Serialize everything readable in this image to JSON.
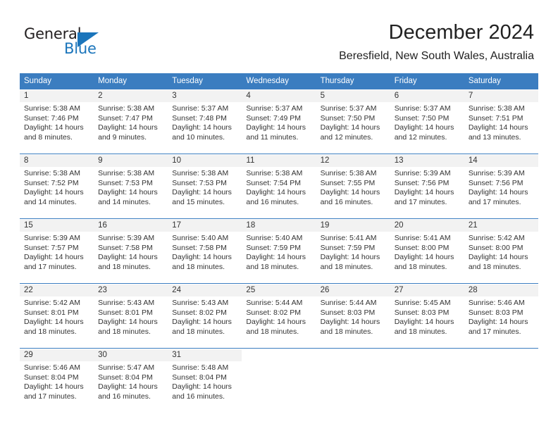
{
  "brand": {
    "name_part1": "General",
    "name_part2": "Blue",
    "triangle_icon": "blue-triangle-logo-icon",
    "accent_color": "#1b75bb"
  },
  "header": {
    "month_title": "December 2024",
    "location": "Beresfield, New South Wales, Australia"
  },
  "calendar": {
    "header_background": "#3b7dc0",
    "daynum_background": "#f2f2f2",
    "weekday_headers": [
      "Sunday",
      "Monday",
      "Tuesday",
      "Wednesday",
      "Thursday",
      "Friday",
      "Saturday"
    ],
    "weeks": [
      [
        {
          "day": "1",
          "sunrise": "Sunrise: 5:38 AM",
          "sunset": "Sunset: 7:46 PM",
          "daylight_line1": "Daylight: 14 hours",
          "daylight_line2": "and 8 minutes."
        },
        {
          "day": "2",
          "sunrise": "Sunrise: 5:38 AM",
          "sunset": "Sunset: 7:47 PM",
          "daylight_line1": "Daylight: 14 hours",
          "daylight_line2": "and 9 minutes."
        },
        {
          "day": "3",
          "sunrise": "Sunrise: 5:37 AM",
          "sunset": "Sunset: 7:48 PM",
          "daylight_line1": "Daylight: 14 hours",
          "daylight_line2": "and 10 minutes."
        },
        {
          "day": "4",
          "sunrise": "Sunrise: 5:37 AM",
          "sunset": "Sunset: 7:49 PM",
          "daylight_line1": "Daylight: 14 hours",
          "daylight_line2": "and 11 minutes."
        },
        {
          "day": "5",
          "sunrise": "Sunrise: 5:37 AM",
          "sunset": "Sunset: 7:50 PM",
          "daylight_line1": "Daylight: 14 hours",
          "daylight_line2": "and 12 minutes."
        },
        {
          "day": "6",
          "sunrise": "Sunrise: 5:37 AM",
          "sunset": "Sunset: 7:50 PM",
          "daylight_line1": "Daylight: 14 hours",
          "daylight_line2": "and 12 minutes."
        },
        {
          "day": "7",
          "sunrise": "Sunrise: 5:38 AM",
          "sunset": "Sunset: 7:51 PM",
          "daylight_line1": "Daylight: 14 hours",
          "daylight_line2": "and 13 minutes."
        }
      ],
      [
        {
          "day": "8",
          "sunrise": "Sunrise: 5:38 AM",
          "sunset": "Sunset: 7:52 PM",
          "daylight_line1": "Daylight: 14 hours",
          "daylight_line2": "and 14 minutes."
        },
        {
          "day": "9",
          "sunrise": "Sunrise: 5:38 AM",
          "sunset": "Sunset: 7:53 PM",
          "daylight_line1": "Daylight: 14 hours",
          "daylight_line2": "and 14 minutes."
        },
        {
          "day": "10",
          "sunrise": "Sunrise: 5:38 AM",
          "sunset": "Sunset: 7:53 PM",
          "daylight_line1": "Daylight: 14 hours",
          "daylight_line2": "and 15 minutes."
        },
        {
          "day": "11",
          "sunrise": "Sunrise: 5:38 AM",
          "sunset": "Sunset: 7:54 PM",
          "daylight_line1": "Daylight: 14 hours",
          "daylight_line2": "and 16 minutes."
        },
        {
          "day": "12",
          "sunrise": "Sunrise: 5:38 AM",
          "sunset": "Sunset: 7:55 PM",
          "daylight_line1": "Daylight: 14 hours",
          "daylight_line2": "and 16 minutes."
        },
        {
          "day": "13",
          "sunrise": "Sunrise: 5:39 AM",
          "sunset": "Sunset: 7:56 PM",
          "daylight_line1": "Daylight: 14 hours",
          "daylight_line2": "and 17 minutes."
        },
        {
          "day": "14",
          "sunrise": "Sunrise: 5:39 AM",
          "sunset": "Sunset: 7:56 PM",
          "daylight_line1": "Daylight: 14 hours",
          "daylight_line2": "and 17 minutes."
        }
      ],
      [
        {
          "day": "15",
          "sunrise": "Sunrise: 5:39 AM",
          "sunset": "Sunset: 7:57 PM",
          "daylight_line1": "Daylight: 14 hours",
          "daylight_line2": "and 17 minutes."
        },
        {
          "day": "16",
          "sunrise": "Sunrise: 5:39 AM",
          "sunset": "Sunset: 7:58 PM",
          "daylight_line1": "Daylight: 14 hours",
          "daylight_line2": "and 18 minutes."
        },
        {
          "day": "17",
          "sunrise": "Sunrise: 5:40 AM",
          "sunset": "Sunset: 7:58 PM",
          "daylight_line1": "Daylight: 14 hours",
          "daylight_line2": "and 18 minutes."
        },
        {
          "day": "18",
          "sunrise": "Sunrise: 5:40 AM",
          "sunset": "Sunset: 7:59 PM",
          "daylight_line1": "Daylight: 14 hours",
          "daylight_line2": "and 18 minutes."
        },
        {
          "day": "19",
          "sunrise": "Sunrise: 5:41 AM",
          "sunset": "Sunset: 7:59 PM",
          "daylight_line1": "Daylight: 14 hours",
          "daylight_line2": "and 18 minutes."
        },
        {
          "day": "20",
          "sunrise": "Sunrise: 5:41 AM",
          "sunset": "Sunset: 8:00 PM",
          "daylight_line1": "Daylight: 14 hours",
          "daylight_line2": "and 18 minutes."
        },
        {
          "day": "21",
          "sunrise": "Sunrise: 5:42 AM",
          "sunset": "Sunset: 8:00 PM",
          "daylight_line1": "Daylight: 14 hours",
          "daylight_line2": "and 18 minutes."
        }
      ],
      [
        {
          "day": "22",
          "sunrise": "Sunrise: 5:42 AM",
          "sunset": "Sunset: 8:01 PM",
          "daylight_line1": "Daylight: 14 hours",
          "daylight_line2": "and 18 minutes."
        },
        {
          "day": "23",
          "sunrise": "Sunrise: 5:43 AM",
          "sunset": "Sunset: 8:01 PM",
          "daylight_line1": "Daylight: 14 hours",
          "daylight_line2": "and 18 minutes."
        },
        {
          "day": "24",
          "sunrise": "Sunrise: 5:43 AM",
          "sunset": "Sunset: 8:02 PM",
          "daylight_line1": "Daylight: 14 hours",
          "daylight_line2": "and 18 minutes."
        },
        {
          "day": "25",
          "sunrise": "Sunrise: 5:44 AM",
          "sunset": "Sunset: 8:02 PM",
          "daylight_line1": "Daylight: 14 hours",
          "daylight_line2": "and 18 minutes."
        },
        {
          "day": "26",
          "sunrise": "Sunrise: 5:44 AM",
          "sunset": "Sunset: 8:03 PM",
          "daylight_line1": "Daylight: 14 hours",
          "daylight_line2": "and 18 minutes."
        },
        {
          "day": "27",
          "sunrise": "Sunrise: 5:45 AM",
          "sunset": "Sunset: 8:03 PM",
          "daylight_line1": "Daylight: 14 hours",
          "daylight_line2": "and 18 minutes."
        },
        {
          "day": "28",
          "sunrise": "Sunrise: 5:46 AM",
          "sunset": "Sunset: 8:03 PM",
          "daylight_line1": "Daylight: 14 hours",
          "daylight_line2": "and 17 minutes."
        }
      ],
      [
        {
          "day": "29",
          "sunrise": "Sunrise: 5:46 AM",
          "sunset": "Sunset: 8:04 PM",
          "daylight_line1": "Daylight: 14 hours",
          "daylight_line2": "and 17 minutes."
        },
        {
          "day": "30",
          "sunrise": "Sunrise: 5:47 AM",
          "sunset": "Sunset: 8:04 PM",
          "daylight_line1": "Daylight: 14 hours",
          "daylight_line2": "and 16 minutes."
        },
        {
          "day": "31",
          "sunrise": "Sunrise: 5:48 AM",
          "sunset": "Sunset: 8:04 PM",
          "daylight_line1": "Daylight: 14 hours",
          "daylight_line2": "and 16 minutes."
        },
        {
          "day": "",
          "sunrise": "",
          "sunset": "",
          "daylight_line1": "",
          "daylight_line2": ""
        },
        {
          "day": "",
          "sunrise": "",
          "sunset": "",
          "daylight_line1": "",
          "daylight_line2": ""
        },
        {
          "day": "",
          "sunrise": "",
          "sunset": "",
          "daylight_line1": "",
          "daylight_line2": ""
        },
        {
          "day": "",
          "sunrise": "",
          "sunset": "",
          "daylight_line1": "",
          "daylight_line2": ""
        }
      ]
    ]
  }
}
